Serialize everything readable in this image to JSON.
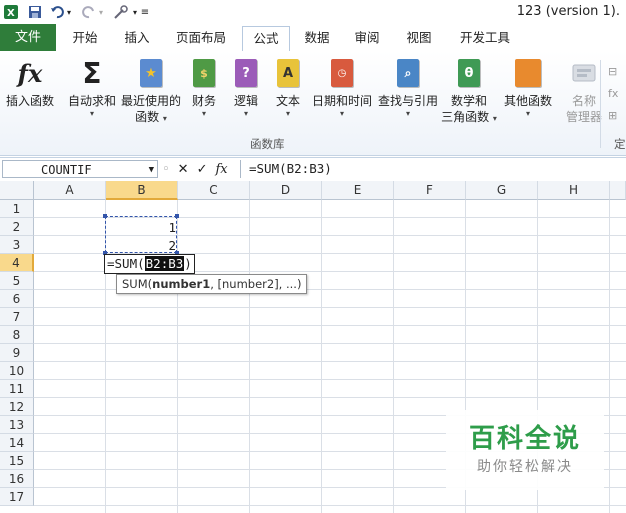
{
  "title_bar": {
    "document_title": "123 (version 1).",
    "quick_access": [
      "excel-app-icon",
      "save-icon",
      "undo-icon",
      "redo-icon",
      "tools-icon",
      "customize-icon"
    ]
  },
  "tabs": [
    {
      "label": "文件",
      "active": false
    },
    {
      "label": "开始",
      "active": false
    },
    {
      "label": "插入",
      "active": false
    },
    {
      "label": "页面布局",
      "active": false
    },
    {
      "label": "公式",
      "active": true
    },
    {
      "label": "数据",
      "active": false
    },
    {
      "label": "审阅",
      "active": false
    },
    {
      "label": "视图",
      "active": false
    },
    {
      "label": "开发工具",
      "active": false
    }
  ],
  "ribbon": {
    "group_label": "函数库",
    "group2_label": "定",
    "buttons": [
      {
        "line1": "插入函数",
        "line2": "",
        "icon": "fx-icon"
      },
      {
        "line1": "自动求和",
        "line2": "",
        "icon": "sigma-icon"
      },
      {
        "line1": "最近使用的",
        "line2": "函数",
        "icon": "star-book-icon"
      },
      {
        "line1": "财务",
        "line2": "",
        "icon": "finance-book-icon"
      },
      {
        "line1": "逻辑",
        "line2": "",
        "icon": "logic-book-icon"
      },
      {
        "line1": "文本",
        "line2": "",
        "icon": "text-book-icon"
      },
      {
        "line1": "日期和时间",
        "line2": "",
        "icon": "datetime-book-icon"
      },
      {
        "line1": "查找与引用",
        "line2": "",
        "icon": "lookup-book-icon"
      },
      {
        "line1": "数学和",
        "line2": "三角函数",
        "icon": "math-book-icon"
      },
      {
        "line1": "其他函数",
        "line2": "",
        "icon": "more-books-icon"
      },
      {
        "line1": "名称",
        "line2": "管理器",
        "icon": "name-manager-icon"
      }
    ]
  },
  "formula_bar": {
    "name_box": "COUNTIF",
    "formula": "=SUM(B2:B3)",
    "fx_label": "fx"
  },
  "sheet": {
    "columns": [
      "A",
      "B",
      "C",
      "D",
      "E",
      "F",
      "G",
      "H"
    ],
    "selected_column": "B",
    "rows": [
      "1",
      "2",
      "3",
      "4",
      "5",
      "6",
      "7",
      "8",
      "9",
      "10",
      "11",
      "12",
      "13",
      "14",
      "15",
      "16",
      "17"
    ],
    "selected_row": "4",
    "cells": {
      "B2": "1",
      "B3": "2"
    },
    "editing_cell": {
      "prefix": "=SUM(",
      "ref": "B2:B3",
      "suffix": ")"
    },
    "tooltip": {
      "func": "SUM(",
      "arg1": "number1",
      "rest": ", [number2], ...)"
    }
  },
  "watermark": {
    "title": "百科全说",
    "subtitle": "助你轻松解决"
  }
}
